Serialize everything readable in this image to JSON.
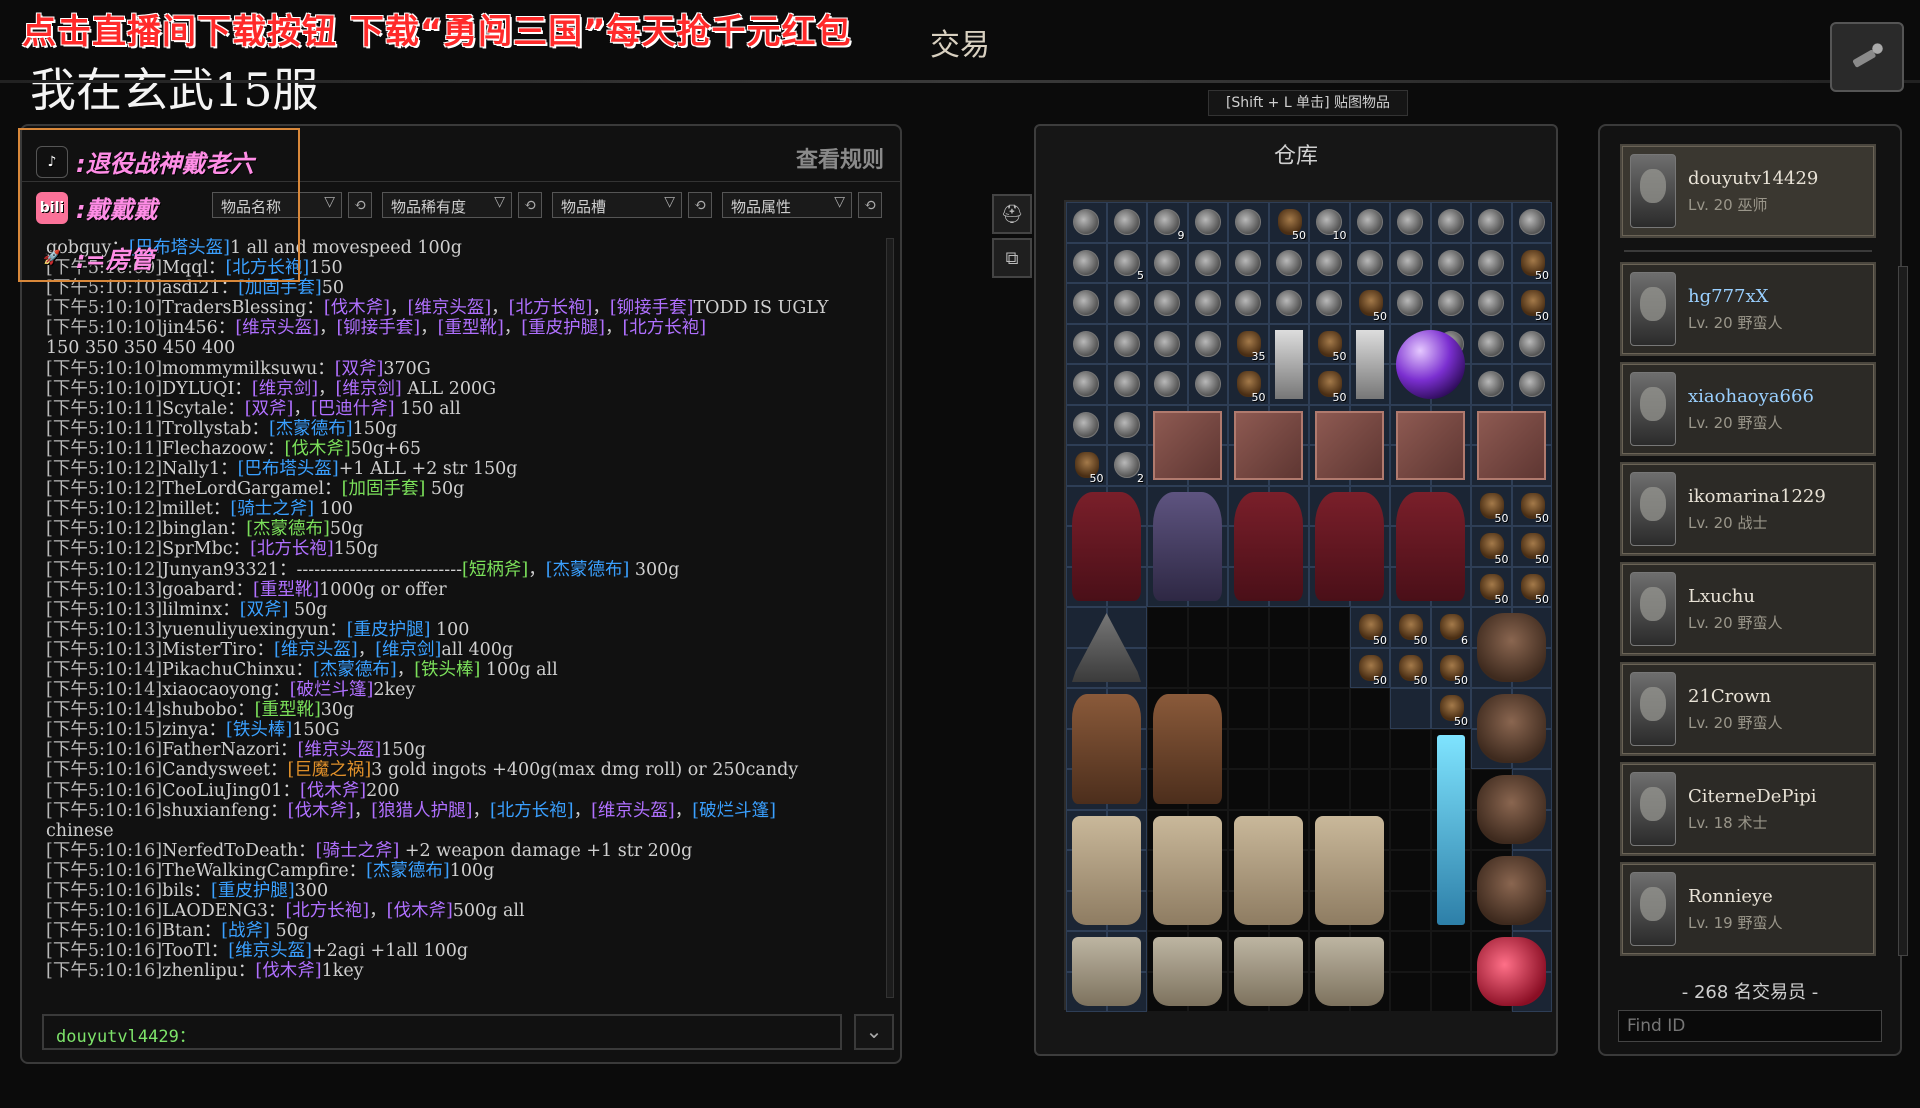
{
  "stream": {
    "promo": "点击直播间下载按钮 下载“勇闯三国”每天抢千元红包",
    "server": "我在玄武15服"
  },
  "header": {
    "title": "交易"
  },
  "chat": {
    "rules_label": "查看规则",
    "overlay": {
      "line1": ":退役战神戴老六",
      "line2": ":戴戴戴",
      "line3": ":=房管"
    },
    "filters": [
      {
        "label": "物品名称"
      },
      {
        "label": "物品稀有度"
      },
      {
        "label": "物品槽"
      },
      {
        "label": "物品属性"
      }
    ],
    "messages": [
      {
        "ts": "",
        "user": "gobguy",
        "parts": [
          [
            "n",
            "："
          ],
          [
            "i",
            "[巴布塔头盔]"
          ],
          [
            "n",
            "1 all and movespeed 100g"
          ]
        ]
      },
      {
        "ts": "[下午5:10:09]",
        "user": "Mqql",
        "parts": [
          [
            "n",
            "："
          ],
          [
            "i",
            "[北方长袍]"
          ],
          [
            "n",
            "150"
          ]
        ]
      },
      {
        "ts": "[下午5:10:10]",
        "user": "asdi21",
        "parts": [
          [
            "n",
            "："
          ],
          [
            "i",
            "[加固手套]"
          ],
          [
            "n",
            "50"
          ]
        ]
      },
      {
        "ts": "[下午5:10:10]",
        "user": "TradersBlessing",
        "parts": [
          [
            "n",
            "："
          ],
          [
            "p",
            "[伐木斧]"
          ],
          [
            "n",
            "，"
          ],
          [
            "p",
            "[维京头盔]"
          ],
          [
            "n",
            "，"
          ],
          [
            "p",
            "[北方长袍]"
          ],
          [
            "n",
            "，"
          ],
          [
            "p",
            "[铆接手套]"
          ],
          [
            "n",
            "TODD IS UGLY"
          ]
        ]
      },
      {
        "ts": "[下午5:10:10]",
        "user": "jin456",
        "parts": [
          [
            "n",
            "："
          ],
          [
            "p",
            "[维京头盔]"
          ],
          [
            "n",
            "，"
          ],
          [
            "p",
            "[铆接手套]"
          ],
          [
            "n",
            "，"
          ],
          [
            "p",
            "[重型靴]"
          ],
          [
            "n",
            "，"
          ],
          [
            "p",
            "[重皮护腿]"
          ],
          [
            "n",
            "，"
          ],
          [
            "p",
            "[北方长袍]"
          ]
        ]
      },
      {
        "ts": "",
        "user": "",
        "parts": [
          [
            "n",
            "              150   350  350  450  400"
          ]
        ]
      },
      {
        "ts": "[下午5:10:10]",
        "user": "mommymilksuwu",
        "parts": [
          [
            "n",
            "："
          ],
          [
            "p",
            "[双斧]"
          ],
          [
            "n",
            "370G"
          ]
        ]
      },
      {
        "ts": "[下午5:10:10]",
        "user": "DYLUQI",
        "parts": [
          [
            "n",
            "："
          ],
          [
            "p",
            "[维京剑]"
          ],
          [
            "n",
            "，"
          ],
          [
            "p",
            "[维京剑]"
          ],
          [
            "n",
            "  ALL  200G"
          ]
        ]
      },
      {
        "ts": "[下午5:10:11]",
        "user": "Scytale",
        "parts": [
          [
            "n",
            "："
          ],
          [
            "p",
            "[双斧]"
          ],
          [
            "n",
            "，"
          ],
          [
            "p",
            "[巴迪什斧]"
          ],
          [
            "n",
            " 150 all"
          ]
        ]
      },
      {
        "ts": "[下午5:10:11]",
        "user": "Trollystab",
        "parts": [
          [
            "n",
            "："
          ],
          [
            "i",
            "[杰蒙德布]"
          ],
          [
            "n",
            "150g"
          ]
        ]
      },
      {
        "ts": "[下午5:10:11]",
        "user": "Flechazoow",
        "parts": [
          [
            "n",
            "："
          ],
          [
            "g",
            "[伐木斧]"
          ],
          [
            "n",
            "50g+65"
          ]
        ]
      },
      {
        "ts": "[下午5:10:12]",
        "user": "Nally1",
        "parts": [
          [
            "n",
            "："
          ],
          [
            "i",
            "[巴布塔头盔]"
          ],
          [
            "n",
            "+1 ALL +2 str 150g"
          ]
        ]
      },
      {
        "ts": "[下午5:10:12]",
        "user": "TheLordGargamel",
        "parts": [
          [
            "n",
            "："
          ],
          [
            "g",
            "[加固手套]"
          ],
          [
            "n",
            " 50g"
          ]
        ]
      },
      {
        "ts": "[下午5:10:12]",
        "user": "millet",
        "parts": [
          [
            "n",
            "："
          ],
          [
            "i",
            "[骑士之斧]"
          ],
          [
            "n",
            " 100"
          ]
        ]
      },
      {
        "ts": "[下午5:10:12]",
        "user": "binglan",
        "parts": [
          [
            "n",
            "："
          ],
          [
            "g",
            "[杰蒙德布]"
          ],
          [
            "n",
            "50g"
          ]
        ]
      },
      {
        "ts": "[下午5:10:12]",
        "user": "SprMbc",
        "parts": [
          [
            "n",
            "："
          ],
          [
            "p",
            "[北方长袍]"
          ],
          [
            "n",
            "150g"
          ]
        ]
      },
      {
        "ts": "[下午5:10:12]",
        "user": "Junyan93321",
        "parts": [
          [
            "n",
            "：----------------------------"
          ],
          [
            "g",
            "[短柄斧]"
          ],
          [
            "n",
            "，"
          ],
          [
            "i",
            "[杰蒙德布]"
          ],
          [
            "n",
            " 300g"
          ]
        ]
      },
      {
        "ts": "[下午5:10:13]",
        "user": "goabard",
        "parts": [
          [
            "n",
            "："
          ],
          [
            "p",
            "[重型靴]"
          ],
          [
            "n",
            "1000g or offer"
          ]
        ]
      },
      {
        "ts": "[下午5:10:13]",
        "user": "lilminx",
        "parts": [
          [
            "n",
            "："
          ],
          [
            "i",
            "[双斧]"
          ],
          [
            "n",
            " 50g"
          ]
        ]
      },
      {
        "ts": "[下午5:10:13]",
        "user": "yuenuliyuexingyun",
        "parts": [
          [
            "n",
            "："
          ],
          [
            "i",
            "[重皮护腿]"
          ],
          [
            "n",
            " 100"
          ]
        ]
      },
      {
        "ts": "[下午5:10:13]",
        "user": "MisterTiro",
        "parts": [
          [
            "n",
            "："
          ],
          [
            "i",
            "[维京头盔]"
          ],
          [
            "n",
            "，"
          ],
          [
            "i",
            "[维京剑]"
          ],
          [
            "n",
            "all 400g"
          ]
        ]
      },
      {
        "ts": "[下午5:10:14]",
        "user": "PikachuChinxu",
        "parts": [
          [
            "n",
            "："
          ],
          [
            "i",
            "[杰蒙德布]"
          ],
          [
            "n",
            "，"
          ],
          [
            "g",
            "[铁头棒]"
          ],
          [
            "n",
            " 100g all"
          ]
        ]
      },
      {
        "ts": "[下午5:10:14]",
        "user": "xiaocaoyong",
        "parts": [
          [
            "n",
            "："
          ],
          [
            "p",
            "[破烂斗篷]"
          ],
          [
            "n",
            "2key"
          ]
        ]
      },
      {
        "ts": "[下午5:10:14]",
        "user": "shubobo",
        "parts": [
          [
            "n",
            "："
          ],
          [
            "g",
            "[重型靴]"
          ],
          [
            "n",
            "30g"
          ]
        ]
      },
      {
        "ts": "[下午5:10:15]",
        "user": "zinya",
        "parts": [
          [
            "n",
            "："
          ],
          [
            "i",
            "[铁头棒]"
          ],
          [
            "n",
            "150G"
          ]
        ]
      },
      {
        "ts": "[下午5:10:16]",
        "user": "FatherNazori",
        "parts": [
          [
            "n",
            "："
          ],
          [
            "p",
            "[维京头盔]"
          ],
          [
            "n",
            "150g"
          ]
        ]
      },
      {
        "ts": "[下午5:10:16]",
        "user": "Candysweet",
        "parts": [
          [
            "n",
            "："
          ],
          [
            "o",
            "[巨魔之祸]"
          ],
          [
            "n",
            "3 gold ingots +400g(max dmg roll) or 250candy"
          ]
        ]
      },
      {
        "ts": "[下午5:10:16]",
        "user": "CooLiuJing01",
        "parts": [
          [
            "n",
            "："
          ],
          [
            "p",
            "[伐木斧]"
          ],
          [
            "n",
            "200"
          ]
        ]
      },
      {
        "ts": "[下午5:10:16]",
        "user": "shuxianfeng",
        "parts": [
          [
            "n",
            "："
          ],
          [
            "p",
            "[伐木斧]"
          ],
          [
            "n",
            "，"
          ],
          [
            "p",
            "[狼猎人护腿]"
          ],
          [
            "n",
            "，"
          ],
          [
            "i",
            "[北方长袍]"
          ],
          [
            "n",
            "，"
          ],
          [
            "p",
            "[维京头盔]"
          ],
          [
            "n",
            "，"
          ],
          [
            "i",
            "[破烂斗篷]"
          ]
        ]
      },
      {
        "ts": "",
        "user": "",
        "parts": [
          [
            "n",
            "                         chinese"
          ]
        ]
      },
      {
        "ts": "[下午5:10:16]",
        "user": "NerfedToDeath",
        "parts": [
          [
            "n",
            "："
          ],
          [
            "p",
            "[骑士之斧]"
          ],
          [
            "n",
            " +2 weapon damage +1 str 200g"
          ]
        ]
      },
      {
        "ts": "[下午5:10:16]",
        "user": "TheWalkingCampfire",
        "parts": [
          [
            "n",
            "："
          ],
          [
            "i",
            "[杰蒙德布]"
          ],
          [
            "n",
            "100g"
          ]
        ]
      },
      {
        "ts": "[下午5:10:16]",
        "user": "bils",
        "parts": [
          [
            "n",
            "："
          ],
          [
            "i",
            "[重皮护腿]"
          ],
          [
            "n",
            "300"
          ]
        ]
      },
      {
        "ts": "[下午5:10:16]",
        "user": "LAODENG3",
        "parts": [
          [
            "n",
            "："
          ],
          [
            "p",
            "[北方长袍]"
          ],
          [
            "n",
            "，"
          ],
          [
            "p",
            "[伐木斧]"
          ],
          [
            "n",
            "500g  all"
          ]
        ]
      },
      {
        "ts": "[下午5:10:16]",
        "user": "Btan",
        "parts": [
          [
            "n",
            "："
          ],
          [
            "i",
            "[战斧]"
          ],
          [
            "n",
            " 50g"
          ]
        ]
      },
      {
        "ts": "[下午5:10:16]",
        "user": "TooTl",
        "parts": [
          [
            "n",
            "："
          ],
          [
            "i",
            "[维京头盔]"
          ],
          [
            "n",
            "+2agi +1all 100g"
          ]
        ]
      },
      {
        "ts": "[下午5:10:16]",
        "user": "zhenlipu",
        "parts": [
          [
            "n",
            "："
          ],
          [
            "p",
            "[伐木斧]"
          ],
          [
            "n",
            "1key"
          ]
        ]
      }
    ],
    "input_prefix": "douyutvl4429："
  },
  "warehouse": {
    "hint": "[Shift + L 单击] 贴图物品",
    "title": "仓库",
    "counts": [
      "9",
      "50",
      "10",
      "5",
      "50",
      "50",
      "50",
      "35",
      "50",
      "50",
      "50",
      "50",
      "2",
      "50",
      "50",
      "50",
      "50",
      "50",
      "50",
      "50",
      "50",
      "6",
      "50",
      "50",
      "50",
      "50",
      "50"
    ]
  },
  "traders": {
    "list": [
      {
        "name": "douyutv14429",
        "level": "Lv. 20 巫师"
      },
      {
        "name": "hg777xX",
        "level": "Lv. 20 野蛮人"
      },
      {
        "name": "xiaohaoya666",
        "level": "Lv. 20 野蛮人"
      },
      {
        "name": "ikomarina1229",
        "level": "Lv. 20 战士"
      },
      {
        "name": "Lxuchu",
        "level": "Lv. 20 野蛮人"
      },
      {
        "name": "21Crown",
        "level": "Lv. 20 野蛮人"
      },
      {
        "name": "CiterneDePipi",
        "level": "Lv. 18 术士"
      },
      {
        "name": "Ronnieye",
        "level": "Lv. 19 野蛮人"
      }
    ],
    "count_label": "- 268 名交易员 -",
    "find_placeholder": "Find ID"
  },
  "colors": {
    "item_blue": "#3aa0ff",
    "item_purple": "#b070ff",
    "item_green": "#7be05a",
    "item_orange": "#e0902a",
    "promo_red": "#ff2a2a",
    "streamer_box": "#d9883a"
  }
}
